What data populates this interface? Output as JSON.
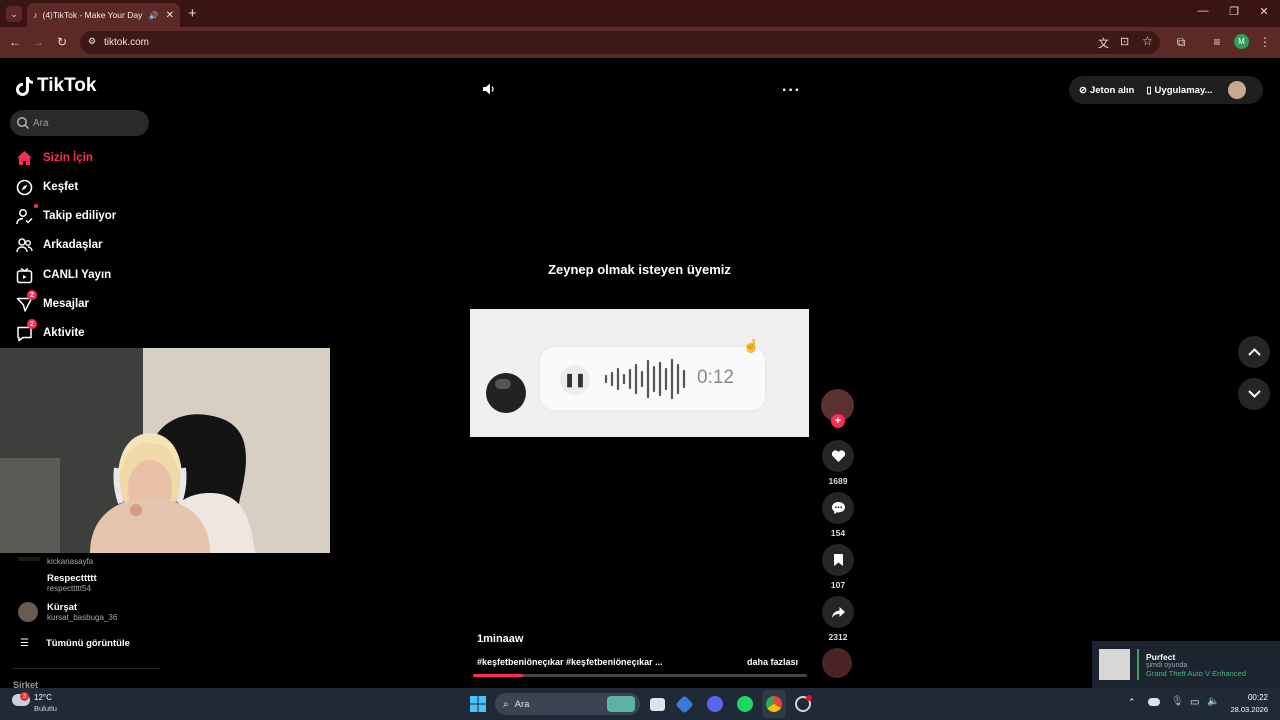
{
  "browser": {
    "tab_title": "(4)TikTok - Make Your Day",
    "url": "tiktok.com",
    "profile_initial": "M"
  },
  "sidebar": {
    "logo": "TikTok",
    "search_placeholder": "Ara",
    "items": [
      {
        "label": "Sizin İçin",
        "icon": "home-icon",
        "active": true
      },
      {
        "label": "Keşfet",
        "icon": "compass-icon"
      },
      {
        "label": "Takip ediliyor",
        "icon": "following-icon"
      },
      {
        "label": "Arkadaşlar",
        "icon": "friends-icon"
      },
      {
        "label": "CANLI Yayın",
        "icon": "live-icon"
      },
      {
        "label": "Mesajlar",
        "icon": "messages-icon",
        "badge": "2"
      },
      {
        "label": "Aktivite",
        "icon": "activity-icon",
        "badge": "2"
      }
    ],
    "accounts": [
      {
        "name": "",
        "username": "kickanasayfa"
      },
      {
        "name": "Respecttttt",
        "username": "respecttttt54"
      },
      {
        "name": "Kürşat",
        "username": "kursat_basbuga_36"
      }
    ],
    "see_all": "Tümünü görüntüle",
    "footer_heading": "Şirket"
  },
  "header": {
    "coins": "Jeton alın",
    "app": "Uygulamay..."
  },
  "video": {
    "caption": "Zeynep olmak  isteyen üyemiz",
    "voice_duration": "0:12",
    "author": "1minaaw",
    "hashtags": "#keşfetbeniöneçıkar #keşfetbeniöneçıkar ...",
    "more_label": "daha fazlası",
    "progress": 0.15,
    "likes": "1689",
    "comments": "154",
    "saves": "107",
    "shares": "2312"
  },
  "toast": {
    "name": "Purfect",
    "status": "şimdi oyunda",
    "game": "Grand Theft Auto V Enhanced"
  },
  "taskbar": {
    "temperature": "12°C",
    "weather": "Bulutlu",
    "weather_badge": "3",
    "search_placeholder": "Ara",
    "time": "00:22",
    "date": "28.03.2026"
  },
  "colors": {
    "accent": "#fe2c55",
    "chrome_tabbar": "#3a1412",
    "chrome_navbar": "#5b2a26",
    "taskbar": "#202a36"
  }
}
